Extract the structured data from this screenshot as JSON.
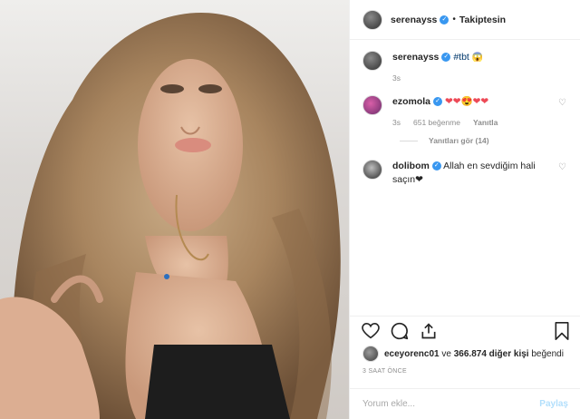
{
  "post": {
    "author": "serenayss",
    "separator": "•",
    "follow_label": "Takiptesin",
    "caption": {
      "user": "serenayss",
      "text": "#tbt",
      "emoji": "😱",
      "time": "3s"
    },
    "comments": [
      {
        "user": "ezomola",
        "text": "❤❤😍❤❤",
        "time": "3s",
        "likes": "651 beğenme",
        "reply_label": "Yanıtla",
        "view_replies": "Yanıtları gör (14)"
      },
      {
        "user": "dolibom",
        "text": "Allah en sevdiğim hali saçın❤"
      }
    ],
    "likes": {
      "user": "eceyorenc01",
      "middle": " ve ",
      "count": "366.874 diğer kişi",
      "suffix": " beğendi"
    },
    "timestamp": "3 SAAT ÖNCE",
    "add_comment_placeholder": "Yorum ekle...",
    "post_button": "Paylaş"
  },
  "icons": {
    "like": "heart-icon",
    "comment": "comment-icon",
    "share": "share-icon",
    "save": "bookmark-icon"
  },
  "colors": {
    "verified": "#3897f0",
    "heart": "#ed4956",
    "muted": "#8e8e8e",
    "post_button": "#b2dffc"
  }
}
